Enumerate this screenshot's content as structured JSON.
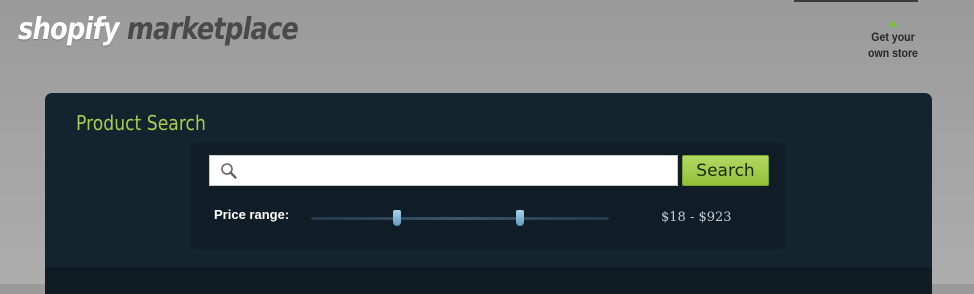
{
  "header": {
    "logo_brand": "shopify",
    "logo_suffix": "marketplace",
    "store_link_line1": "Get your",
    "store_link_line2": "own store"
  },
  "search_panel": {
    "title": "Product Search",
    "search_placeholder": "",
    "search_value": "",
    "search_button_label": "Search",
    "price_range_label": "Price range:",
    "price_range_value": "$18 - $923",
    "slider": {
      "min_fraction": 0.29,
      "max_fraction": 0.7
    }
  },
  "colors": {
    "accent_green": "#a8cc52",
    "panel_bg": "#14242f",
    "button_green": "#92c13a"
  },
  "icons": [
    "search-icon",
    "arrow-up-icon"
  ]
}
